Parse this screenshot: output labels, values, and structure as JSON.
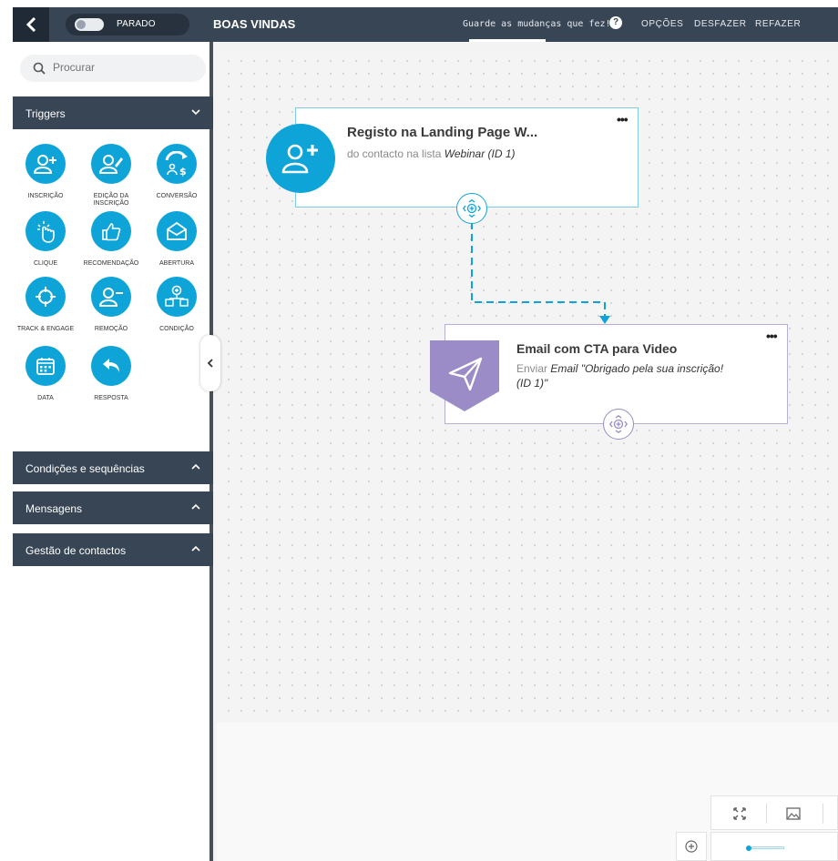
{
  "topbar": {
    "status_label": "PARADO",
    "title": "BOAS VINDAS",
    "save_message": "Guarde as mudanças que fez!",
    "menu": [
      "OPÇÕES",
      "DESFAZER",
      "REFAZER"
    ]
  },
  "sidebar": {
    "search_placeholder": "Procurar",
    "triggers_label": "Triggers",
    "triggers": [
      {
        "label": "INSCRIÇÃO",
        "icon": "user-plus-icon"
      },
      {
        "label": "EDIÇÃO DA INSCRIÇÃO",
        "icon": "user-edit-icon"
      },
      {
        "label": "CONVERSÃO",
        "icon": "conversion-icon"
      },
      {
        "label": "CLIQUE",
        "icon": "click-icon"
      },
      {
        "label": "RECOMENDAÇÃO",
        "icon": "thumbs-up-icon"
      },
      {
        "label": "ABERTURA",
        "icon": "envelope-open-icon"
      },
      {
        "label": "TRACK & ENGAGE",
        "icon": "crosshair-icon"
      },
      {
        "label": "REMOÇÃO",
        "icon": "user-minus-icon"
      },
      {
        "label": "CONDIÇÃO",
        "icon": "condition-icon"
      },
      {
        "label": "DATA",
        "icon": "calendar-icon"
      },
      {
        "label": "RESPOSTA",
        "icon": "reply-icon"
      }
    ],
    "sections": [
      "Condições e sequências",
      "Mensagens",
      "Gestão de contactos"
    ]
  },
  "nodes": {
    "trigger": {
      "title": "Registo na Landing Page W...",
      "desc_prefix": "do contacto na lista ",
      "desc_italic": "Webinar (ID 1)"
    },
    "action": {
      "title": "Email com CTA para Video",
      "desc_prefix": "Enviar ",
      "desc_italic": "Email \"Obrigado pela sua inscrição! (ID 1)\""
    }
  },
  "colors": {
    "topbar": "#384555",
    "trigger_blue": "#0fa4d8",
    "action_purple": "#9b8bc7"
  }
}
